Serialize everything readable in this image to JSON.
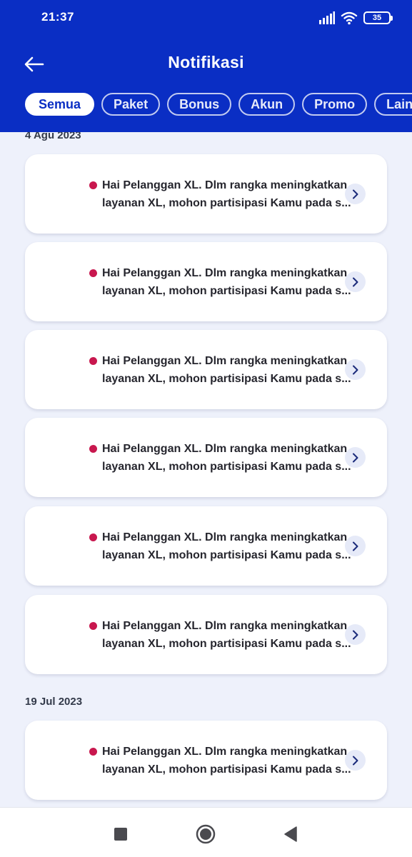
{
  "status_bar": {
    "time": "21:37",
    "battery_level": "35"
  },
  "header": {
    "title": "Notifikasi"
  },
  "tabs": [
    {
      "label": "Semua",
      "active": true
    },
    {
      "label": "Paket",
      "active": false
    },
    {
      "label": "Bonus",
      "active": false
    },
    {
      "label": "Akun",
      "active": false
    },
    {
      "label": "Promo",
      "active": false
    },
    {
      "label": "Lainnya",
      "active": false
    }
  ],
  "groups": [
    {
      "date": "4 Agu 2023",
      "items": [
        {
          "line1": "Hai Pelanggan XL. Dlm rangka meningkatkan",
          "line2": "layanan XL, mohon partisipasi Kamu pada s..."
        },
        {
          "line1": "Hai Pelanggan XL. Dlm rangka meningkatkan",
          "line2": "layanan XL, mohon partisipasi Kamu pada s..."
        },
        {
          "line1": "Hai Pelanggan XL. Dlm rangka meningkatkan",
          "line2": "layanan XL, mohon partisipasi Kamu pada s..."
        },
        {
          "line1": "Hai Pelanggan XL. Dlm rangka meningkatkan",
          "line2": "layanan XL, mohon partisipasi Kamu pada s..."
        },
        {
          "line1": "Hai Pelanggan XL. Dlm rangka meningkatkan",
          "line2": "layanan XL, mohon partisipasi Kamu pada s..."
        },
        {
          "line1": "Hai Pelanggan XL. Dlm rangka meningkatkan",
          "line2": "layanan XL, mohon partisipasi Kamu pada s..."
        }
      ]
    },
    {
      "date": "19 Jul 2023",
      "items": [
        {
          "line1": "Hai Pelanggan XL. Dlm rangka meningkatkan",
          "line2": "layanan XL, mohon partisipasi Kamu pada s..."
        }
      ]
    }
  ],
  "colors": {
    "header_bg": "#0a2ec4",
    "unread_dot": "#c8174e",
    "page_bg": "#eef1fb"
  },
  "icons": {
    "back": "arrow-left-icon",
    "chevron": "chevron-right-icon",
    "nav_recents": "square-icon",
    "nav_home": "circle-icon",
    "nav_back": "triangle-back-icon"
  }
}
